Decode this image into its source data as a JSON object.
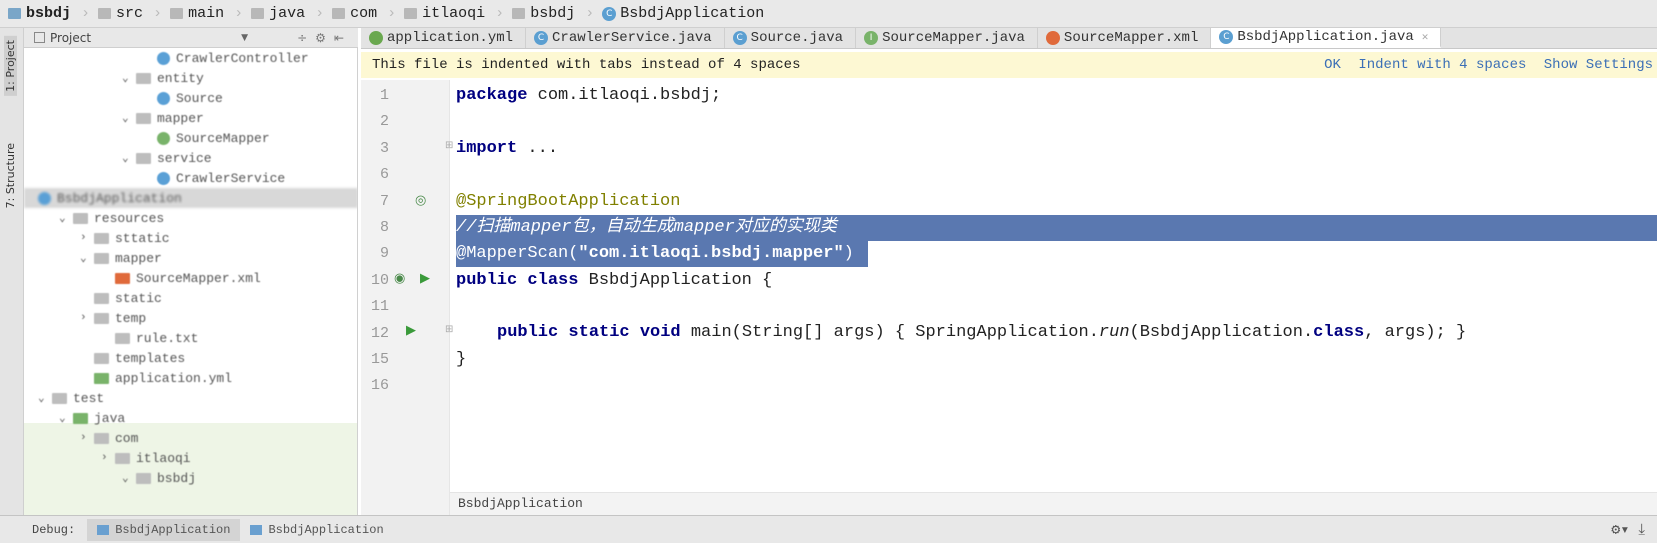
{
  "breadcrumb": [
    "bsbdj",
    "src",
    "main",
    "java",
    "com",
    "itlaoqi",
    "bsbdj",
    "BsbdjApplication"
  ],
  "left_strip": {
    "project_label": "1: Project",
    "structure_label": "7: Structure"
  },
  "project_panel": {
    "title": "Project",
    "tree": [
      {
        "label": "CrawlerController",
        "depth": 5,
        "icon": "class",
        "expanded": null
      },
      {
        "label": "entity",
        "depth": 4,
        "icon": "folder",
        "expanded": true
      },
      {
        "label": "Source",
        "depth": 5,
        "icon": "class",
        "expanded": null
      },
      {
        "label": "mapper",
        "depth": 4,
        "icon": "folder",
        "expanded": true
      },
      {
        "label": "SourceMapper",
        "depth": 5,
        "icon": "interface",
        "expanded": null
      },
      {
        "label": "service",
        "depth": 4,
        "icon": "folder",
        "expanded": true
      },
      {
        "label": "CrawlerService",
        "depth": 5,
        "icon": "class",
        "expanded": null
      },
      {
        "label": "BsbdjApplication",
        "depth": 4,
        "icon": "class",
        "expanded": null,
        "selected": true
      },
      {
        "label": "resources",
        "depth": 1,
        "icon": "folder",
        "expanded": true
      },
      {
        "label": "sttatic",
        "depth": 2,
        "icon": "folder",
        "expanded": false
      },
      {
        "label": "mapper",
        "depth": 2,
        "icon": "folder",
        "expanded": true
      },
      {
        "label": "SourceMapper.xml",
        "depth": 3,
        "icon": "xml",
        "expanded": null
      },
      {
        "label": "static",
        "depth": 2,
        "icon": "folder",
        "expanded": null
      },
      {
        "label": "temp",
        "depth": 2,
        "icon": "folder",
        "expanded": false
      },
      {
        "label": "rule.txt",
        "depth": 3,
        "icon": "file",
        "expanded": null
      },
      {
        "label": "templates",
        "depth": 2,
        "icon": "folder",
        "expanded": null
      },
      {
        "label": "application.yml",
        "depth": 2,
        "icon": "yml",
        "expanded": null
      },
      {
        "label": "test",
        "depth": 0,
        "icon": "folder",
        "expanded": true
      },
      {
        "label": "java",
        "depth": 1,
        "icon": "folder-green",
        "expanded": true
      },
      {
        "label": "com",
        "depth": 2,
        "icon": "folder",
        "expanded": false
      },
      {
        "label": "itlaoqi",
        "depth": 3,
        "icon": "folder",
        "expanded": false
      },
      {
        "label": "bsbdj",
        "depth": 4,
        "icon": "folder",
        "expanded": true
      }
    ]
  },
  "tabs": [
    {
      "label": "application.yml",
      "icon": "yml-icon",
      "color": "#6aa84f",
      "active": false
    },
    {
      "label": "CrawlerService.java",
      "icon": "class-icon",
      "color": "#5b9fd1",
      "active": false
    },
    {
      "label": "Source.java",
      "icon": "class-icon",
      "color": "#5b9fd1",
      "active": false
    },
    {
      "label": "SourceMapper.java",
      "icon": "interface-icon",
      "color": "#79b36a",
      "active": false
    },
    {
      "label": "SourceMapper.xml",
      "icon": "xml-icon",
      "color": "#e06a3b",
      "active": false
    },
    {
      "label": "BsbdjApplication.java",
      "icon": "spring-class-icon",
      "color": "#5b9fd1",
      "active": true
    }
  ],
  "notice": {
    "message": "This file is indented with tabs instead of 4 spaces",
    "ok": "OK",
    "indent": "Indent with 4 spaces",
    "settings": "Show Settings"
  },
  "code": {
    "line_numbers": [
      "1",
      "2",
      "3",
      "6",
      "7",
      "8",
      "9",
      "10",
      "11",
      "12",
      "15",
      "16"
    ],
    "line1_kw": "package",
    "line1_rest": " com.itlaoqi.bsbdj;",
    "line3_kw": "import",
    "line3_rest": " ...",
    "line7": "@SpringBootApplication",
    "line8": "//扫描mapper包，自动生成mapper对应的实现类",
    "line9_a": "@MapperScan(",
    "line9_str": "\"com.itlaoqi.bsbdj.mapper\"",
    "line9_b": ")",
    "line10_kw": "public class",
    "line10_rest": " BsbdjApplication {",
    "line12_kw": "public static void",
    "line12_a": " main(String[] args) { SpringApplication.",
    "line12_run": "run",
    "line12_b": "(BsbdjApplication.",
    "line12_class": "class",
    "line12_c": ", args); }",
    "line15": "}"
  },
  "editor_breadcrumb": "BsbdjApplication",
  "debug": {
    "label": "Debug:",
    "tabs": [
      "BsbdjApplication",
      "BsbdjApplication"
    ]
  },
  "colors": {
    "selection": "#5a78b0",
    "notice_bg": "#fdf8d3",
    "keyword": "#000080",
    "annotation": "#808000",
    "string": "#008000"
  }
}
